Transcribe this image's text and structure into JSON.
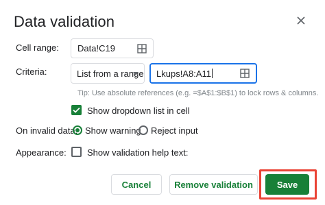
{
  "dialog": {
    "title": "Data validation"
  },
  "cell_range": {
    "label": "Cell range:",
    "value": "Data!C19"
  },
  "criteria": {
    "label": "Criteria:",
    "type_selected": "List from a range",
    "range_value": "Lkups!A8:A11",
    "tip": "Tip: Use absolute references (e.g. =$A$1:$B$1) to lock rows & columns."
  },
  "dropdown": {
    "label": "Show dropdown list in cell",
    "checked": true
  },
  "invalid_data": {
    "label": "On invalid data:",
    "options": [
      "Show warning",
      "Reject input"
    ],
    "selected": "Show warning"
  },
  "appearance": {
    "label": "Appearance:",
    "help_text_label": "Show validation help text:",
    "checked": false
  },
  "buttons": {
    "cancel": "Cancel",
    "remove": "Remove validation",
    "save": "Save"
  },
  "colors": {
    "accent_green": "#188038",
    "focus_blue": "#1a73e8",
    "highlight_red": "#ea4335"
  },
  "icons": [
    "close-icon",
    "grid-select-icon",
    "chevron-down-icon",
    "checkmark-icon"
  ]
}
